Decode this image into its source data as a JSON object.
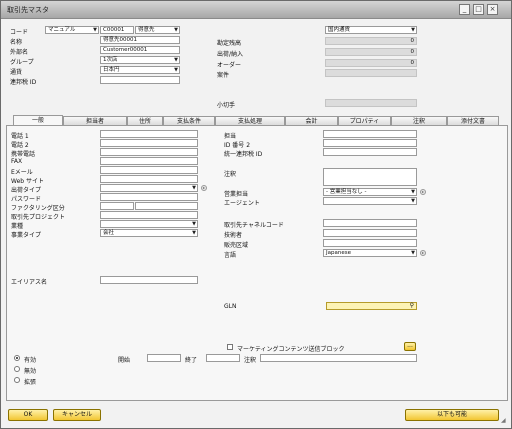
{
  "window": {
    "title": "取引先マスタ"
  },
  "header": {
    "code_label": "コード",
    "series_value": "マニュアル",
    "code_value": "C00001",
    "type_value": "得意先",
    "name_label": "名称",
    "name_value": "得意先00001",
    "foreign_name_label": "外部名",
    "foreign_name_value": "Customer00001",
    "group_label": "グループ",
    "group_value": "1次店",
    "currency_label": "通貨",
    "currency_value": "日本円",
    "tax_id_label": "連邦税 ID",
    "tax_id_value": "",
    "right_dropdown_value": "国内通貨",
    "balance_label": "勘定残高",
    "balance_value": "0",
    "shipments_label": "出荷/納入",
    "shipments_value": "0",
    "orders_label": "オーダー",
    "orders_value": "0",
    "opportunities_label": "案件",
    "opportunities_value": "",
    "checks_label": "小切手",
    "checks_value": ""
  },
  "tabs": [
    "一般",
    "担当者",
    "住所",
    "支払条件",
    "支払処理",
    "会計",
    "プロパティ",
    "注釈",
    "添付文書"
  ],
  "general": {
    "left_labels": [
      "電話 1",
      "電話 2",
      "携帯電話",
      "FAX",
      "Eメール",
      "Web サイト",
      "出荷タイプ",
      "パスワード",
      "ファクタリング区分",
      "取引先プロジェクト",
      "業種",
      "事業タイプ"
    ],
    "business_type_value": "会社",
    "alias_label": "エイリアス名",
    "alias_value": "",
    "right_labels_top": [
      "担当",
      "ID 番号 2",
      "統一連邦税 ID"
    ],
    "remarks_label": "注釈",
    "sales_employee_label": "営業担当",
    "sales_employee_value": "- 営業担当なし -",
    "agent_label": "エージェント",
    "right_labels_bottom": [
      "取引先チャネルコード",
      "技術者",
      "販売区域",
      "言語"
    ],
    "language_value": "Japanese",
    "gln_label": "GLN",
    "gln_value": "",
    "marketing_block_label": "マーケティングコンテンツ送信ブロック",
    "ellipsis_label": "...",
    "status_options": [
      "有効",
      "無効",
      "拡張"
    ],
    "from_label": "開始",
    "to_label": "終了",
    "remarks2_label": "注釈"
  },
  "footer": {
    "ok_label": "OK",
    "cancel_label": "キャンセル",
    "copy_to_label": "以下も可能"
  }
}
